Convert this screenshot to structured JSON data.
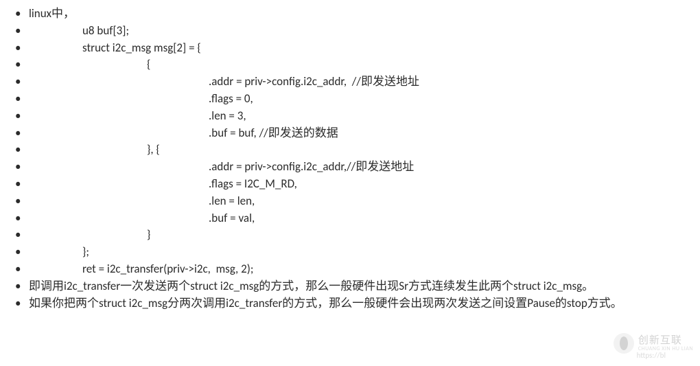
{
  "lines": {
    "l1": "linux中，",
    "l2": "u8 buf[3];",
    "l3": "struct i2c_msg msg[2] = {",
    "l4": "{",
    "l5": ".addr = priv->config.i2c_addr,  //即发送地址",
    "l6": ".flags = 0,",
    "l7": ".len = 3,",
    "l8": ".buf = buf, //即发送的数据",
    "l9": "}, {",
    "l10": ".addr = priv->config.i2c_addr,//即发送地址",
    "l11": ".flags = I2C_M_RD,",
    "l12": ".len = len,",
    "l13": ".buf = val,",
    "l14": "}",
    "l15": "};",
    "l16": "ret = i2c_transfer(priv->i2c,  msg, 2);",
    "para1": "即调用i2c_transfer一次发送两个struct  i2c_msg的方式，那么一般硬件出现Sr方式连续发生此两个struct i2c_msg。",
    "para2": "如果你把两个struct i2c_msg分两次调用i2c_transfer的方式，那么一般硬件会出现两次发送之间设置Pause的stop方式。"
  },
  "watermark": {
    "cn": "创新互联",
    "en": "CHUANG XIN HU LIAN",
    "url": "https://bl"
  }
}
